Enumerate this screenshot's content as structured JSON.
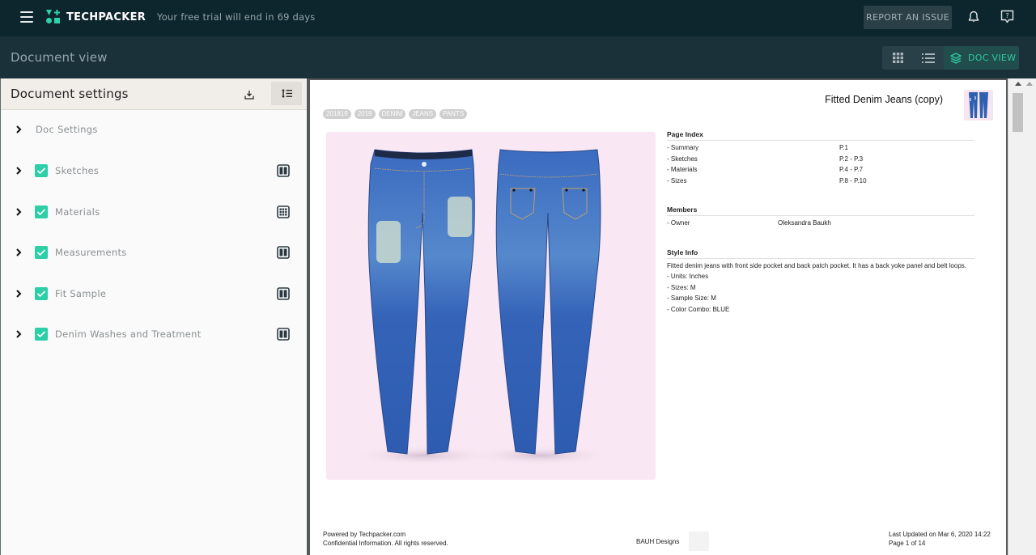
{
  "app": {
    "brand": "TECHPACKER",
    "trial_notice": "Your free trial will end in 69 days",
    "report_button": "REPORT AN ISSUE",
    "accent_color": "#2dcfa6"
  },
  "subheader": {
    "title": "Document view",
    "views": [
      {
        "name": "grid",
        "icon": "grid-icon",
        "active": false
      },
      {
        "name": "list",
        "icon": "list-icon",
        "active": false
      },
      {
        "name": "doc",
        "icon": "layers-icon",
        "label": "DOC VIEW",
        "active": true
      }
    ]
  },
  "settings_panel": {
    "title": "Document settings",
    "items": [
      {
        "label": "Doc Settings",
        "checked": null,
        "layout_icon": null
      },
      {
        "label": "Sketches",
        "checked": true,
        "layout_icon": "two-column-icon"
      },
      {
        "label": "Materials",
        "checked": true,
        "layout_icon": "grid-layout-icon"
      },
      {
        "label": "Measurements",
        "checked": true,
        "layout_icon": "two-column-icon"
      },
      {
        "label": "Fit Sample",
        "checked": true,
        "layout_icon": "two-column-icon"
      },
      {
        "label": "Denim Washes and Treatment",
        "checked": true,
        "layout_icon": "two-column-icon"
      }
    ]
  },
  "document": {
    "title": "Fitted Denim Jeans (copy)",
    "tags": [
      "201819",
      "2019",
      "DENIM",
      "JEANS",
      "PANTS"
    ],
    "page_index": {
      "title": "Page Index",
      "rows": [
        {
          "label": "- Summary",
          "value": "P.1"
        },
        {
          "label": "- Sketches",
          "value": "P.2 - P.3"
        },
        {
          "label": "- Materials",
          "value": "P.4 - P.7"
        },
        {
          "label": "- Sizes",
          "value": "P.8 - P.10"
        }
      ]
    },
    "members": {
      "title": "Members",
      "rows": [
        {
          "label": "- Owner",
          "value": "Oleksandra Baukh"
        }
      ]
    },
    "style_info": {
      "title": "Style Info",
      "description": "Fitted denim jeans with front side pocket and back patch pocket. It has a back yoke panel and belt loops.",
      "lines": [
        "- Units: Inches",
        "- Sizes: M",
        "- Sample Size: M",
        "- Color Combo: BLUE"
      ]
    },
    "footer": {
      "powered_by": "Powered by Techpacker.com",
      "confidential": "Confidential Information. All rights reserved.",
      "company": "BAUH Designs",
      "last_updated": "Last Updated on Mar 6, 2020 14:22",
      "page": "Page 1 of 14"
    }
  }
}
